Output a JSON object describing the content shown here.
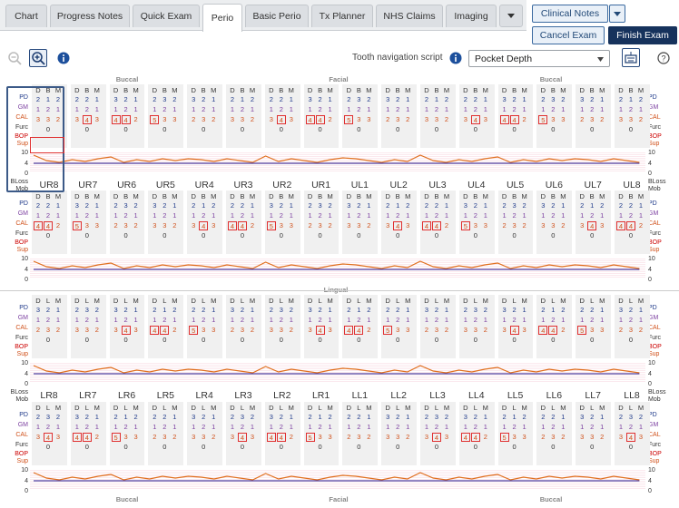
{
  "tabs": [
    {
      "label": "Chart"
    },
    {
      "label": "Progress Notes"
    },
    {
      "label": "Quick Exam"
    },
    {
      "label": "Perio"
    },
    {
      "label": "Basic Perio"
    },
    {
      "label": "Tx Planner"
    },
    {
      "label": "NHS Claims"
    },
    {
      "label": "Imaging"
    }
  ],
  "buttons": {
    "clinical_notes": "Clinical Notes",
    "cancel_exam": "Cancel Exam",
    "finish_exam": "Finish Exam"
  },
  "toolbar": {
    "nav_label": "Tooth navigation script",
    "nav_select": "Pocket Depth"
  },
  "sections": {
    "buccal": "Buccal",
    "facial": "Facial",
    "lingual": "Lingual"
  },
  "row_labels": {
    "pd": "PD",
    "gm": "GM",
    "cal": "CAL",
    "furc": "Furc",
    "bop": "BOP",
    "sup": "Sup",
    "bloss": "BLoss",
    "mob": "Mob",
    "ten": "10",
    "four": "4",
    "zero": "0"
  },
  "upper_teeth": [
    "UR8",
    "UR7",
    "UR6",
    "UR5",
    "UR4",
    "UR3",
    "UR2",
    "UR1",
    "UL1",
    "UL2",
    "UL3",
    "UL4",
    "UL5",
    "UL6",
    "UL7",
    "UL8"
  ],
  "lower_teeth": [
    "LR8",
    "LR7",
    "LR6",
    "LR5",
    "LR4",
    "LR3",
    "LR2",
    "LR1",
    "LL1",
    "LL2",
    "LL3",
    "LL4",
    "LL5",
    "LL6",
    "LL7",
    "LL8"
  ],
  "colors": {
    "pd": "#1f3a8a",
    "gm": "#7b3fa0",
    "cal": "#d0501a",
    "boxes": "#e03030",
    "line_orange": "#e07020",
    "line_purple": "#5040a0"
  }
}
